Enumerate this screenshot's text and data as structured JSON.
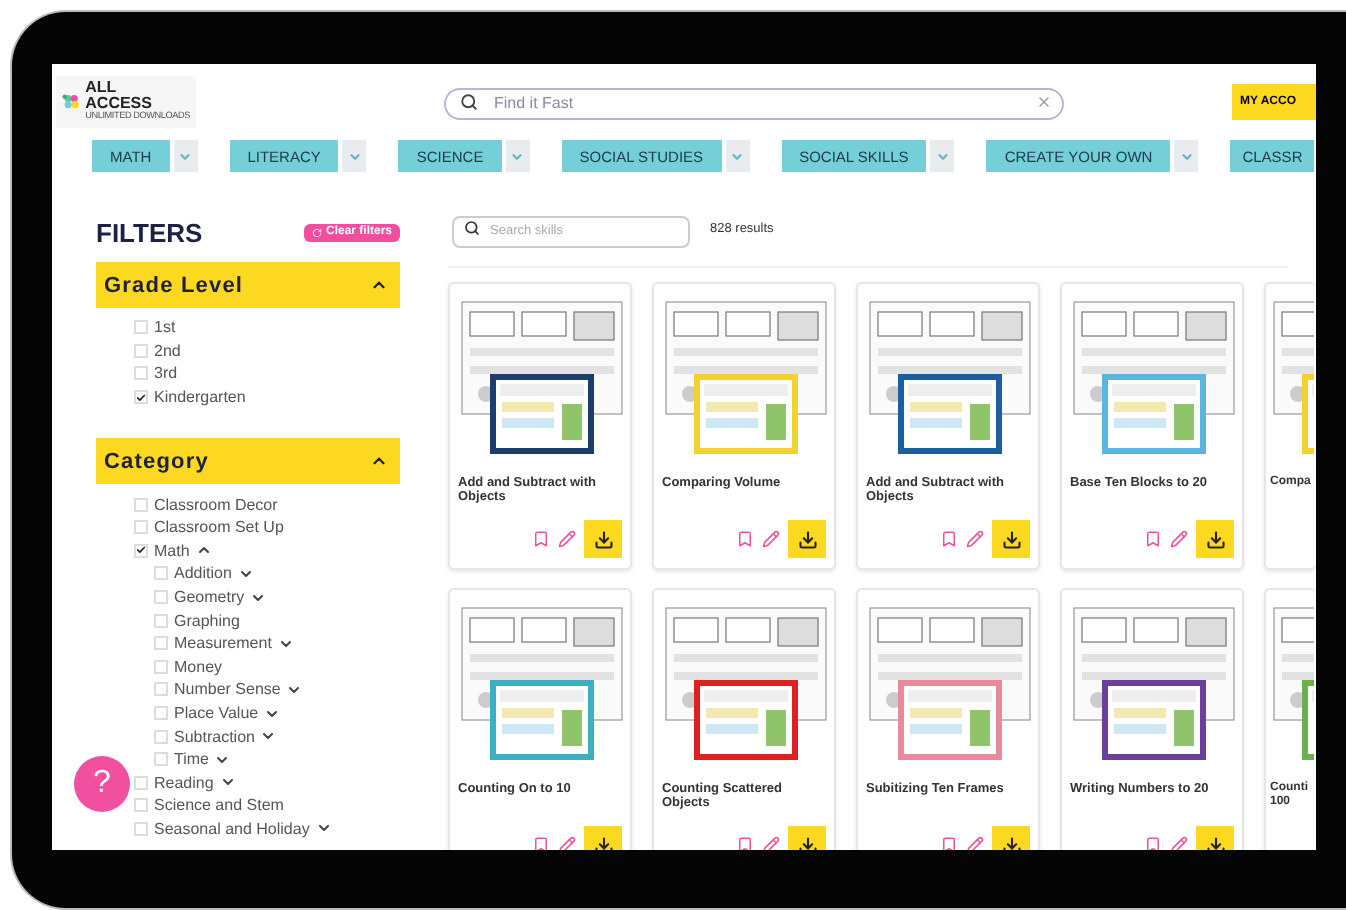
{
  "header": {
    "logo": {
      "lines": [
        "ALL",
        "ACCESS"
      ],
      "tagline": "UNLIMITED DOWNLOADS"
    },
    "search": {
      "placeholder": "Find it Fast"
    },
    "account_button": "MY ACCO"
  },
  "nav": [
    {
      "label": "MATH",
      "dropdown": true
    },
    {
      "label": "LITERACY",
      "dropdown": true
    },
    {
      "label": "SCIENCE",
      "dropdown": true
    },
    {
      "label": "SOCIAL STUDIES",
      "dropdown": true
    },
    {
      "label": "SOCIAL SKILLS",
      "dropdown": true
    },
    {
      "label": "CREATE YOUR OWN",
      "dropdown": true
    },
    {
      "label": "CLASSR",
      "dropdown": false
    }
  ],
  "filters": {
    "title": "FILTERS",
    "clear_button": "Clear filters",
    "sections": [
      {
        "title": "Grade Level",
        "expanded": true,
        "options": [
          {
            "label": "1st",
            "checked": false
          },
          {
            "label": "2nd",
            "checked": false
          },
          {
            "label": "3rd",
            "checked": false
          },
          {
            "label": "Kindergarten",
            "checked": true
          }
        ]
      },
      {
        "title": "Category",
        "expanded": true,
        "options": [
          {
            "label": "Classroom Decor",
            "checked": false
          },
          {
            "label": "Classroom Set Up",
            "checked": false
          },
          {
            "label": "Math",
            "checked": true,
            "expanded": true,
            "children": [
              {
                "label": "Addition",
                "checked": false,
                "expanded": false
              },
              {
                "label": "Geometry",
                "checked": false,
                "expanded": false
              },
              {
                "label": "Graphing",
                "checked": false
              },
              {
                "label": "Measurement",
                "checked": false,
                "expanded": false
              },
              {
                "label": "Money",
                "checked": false
              },
              {
                "label": "Number Sense",
                "checked": false,
                "expanded": false
              },
              {
                "label": "Place Value",
                "checked": false,
                "expanded": false
              },
              {
                "label": "Subtraction",
                "checked": false,
                "expanded": false
              },
              {
                "label": "Time",
                "checked": false,
                "expanded": false
              }
            ]
          },
          {
            "label": "Reading",
            "checked": false,
            "expanded": false
          },
          {
            "label": "Science and Stem",
            "checked": false
          },
          {
            "label": "Seasonal and Holiday",
            "checked": false,
            "expanded": false
          }
        ]
      }
    ]
  },
  "results": {
    "search": {
      "placeholder": "Search skills"
    },
    "count": "828 results"
  },
  "cards": [
    {
      "title": "Add and Subtract with Objects",
      "kind": "full"
    },
    {
      "title": "Comparing Volume",
      "kind": "full"
    },
    {
      "title": "Add and Subtract with Objects",
      "kind": "full"
    },
    {
      "title": "Base Ten Blocks to 20",
      "kind": "full"
    },
    {
      "title": "Compa",
      "kind": "cut"
    },
    {
      "title": "Counting On to 10",
      "kind": "full"
    },
    {
      "title": "Counting Scattered Objects",
      "kind": "full"
    },
    {
      "title": "Subitizing Ten Frames",
      "kind": "full"
    },
    {
      "title": "Writing Numbers to 20",
      "kind": "full"
    },
    {
      "title": "Counti 100",
      "kind": "cut"
    }
  ],
  "help_button": "?"
}
